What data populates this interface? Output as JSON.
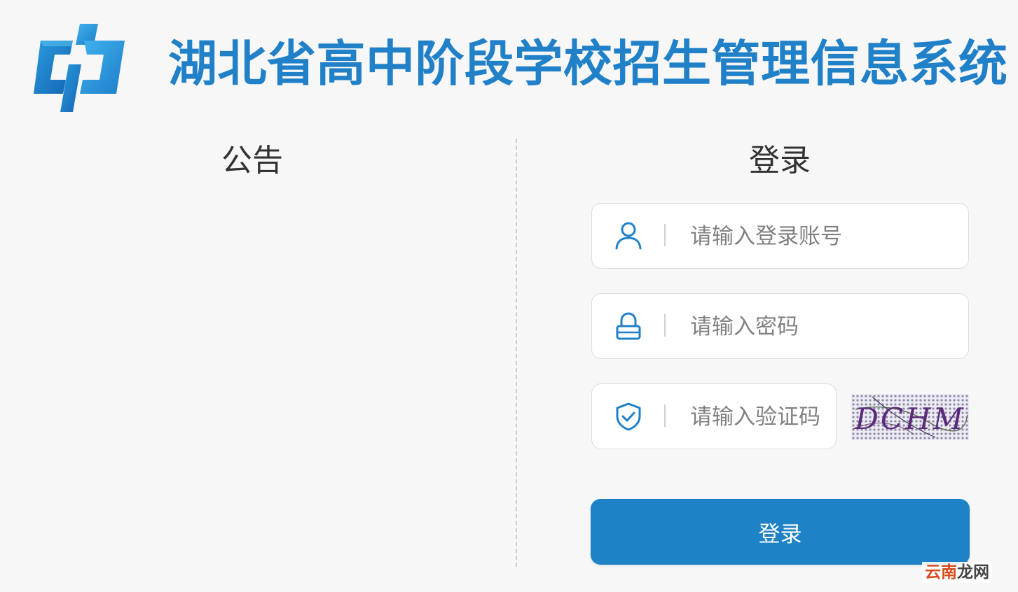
{
  "header": {
    "logo_icon": "blue-cp-logo-icon",
    "system_title": "湖北省高中阶段学校招生管理信息系统"
  },
  "notice": {
    "title": "公告"
  },
  "login": {
    "title": "登录",
    "username": {
      "placeholder": "请输入登录账号",
      "value": "",
      "icon": "user-icon"
    },
    "password": {
      "placeholder": "请输入密码",
      "value": "",
      "icon": "lock-icon"
    },
    "captcha_field": {
      "placeholder": "请输入验证码",
      "value": "",
      "icon": "shield-check-icon"
    },
    "captcha_image_text": "DCHM",
    "submit_label": "登录"
  },
  "watermark": {
    "part1": "云南",
    "part2": "龙网"
  },
  "colors": {
    "brand_blue": "#2080c8",
    "button_blue": "#1e82c6",
    "background": "#f7f7f7",
    "input_border": "#dcdcdc"
  }
}
